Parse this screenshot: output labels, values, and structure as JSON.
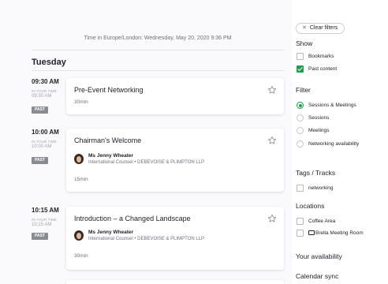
{
  "schedule": {
    "timezone_note": "Time in Europe/London: Wednesday, May 20, 2020 9:36 PM",
    "day": "Tuesday",
    "your_time_label": "IN YOUR TIME:",
    "past_badge": "PAST",
    "sessions": [
      {
        "time": "09:30 AM",
        "your_time": "09:30 AM",
        "title": "Pre-Event Networking",
        "duration": "30min"
      },
      {
        "time": "10:00 AM",
        "your_time": "10:00 AM",
        "title": "Chairman's Welcome",
        "speaker_name": "Ms Jenny Wheater",
        "speaker_role": "International Counsel • DEBEVOISE & PLIMPTON LLP",
        "duration": "15min"
      },
      {
        "time": "10:15 AM",
        "your_time": "10:15 AM",
        "title": "Introduction – a Changed Landscape",
        "speaker_name": "Ms Jenny Wheater",
        "speaker_role": "International Counsel • DEBEVOISE & PLIMPTON LLP",
        "duration": "30min"
      }
    ]
  },
  "filters": {
    "clear_label": "Clear filters",
    "show_title": "Show",
    "show_options": [
      {
        "label": "Bookmarks",
        "checked": false
      },
      {
        "label": "Past content",
        "checked": true
      }
    ],
    "filter_title": "Filter",
    "filter_options": [
      {
        "label": "Sessions & Meetings",
        "selected": true
      },
      {
        "label": "Sessions",
        "selected": false
      },
      {
        "label": "Meetings",
        "selected": false
      },
      {
        "label": "Networking availability",
        "selected": false
      }
    ],
    "tags_title": "Tags / Tracks",
    "tags_options": [
      {
        "label": "networking",
        "checked": false
      }
    ],
    "locations_title": "Locations",
    "locations_options": [
      {
        "label": "Coffee Area",
        "checked": false
      },
      {
        "label": "Brella Meeting Room",
        "checked": false,
        "icon": "meeting-room-icon"
      }
    ],
    "availability_title": "Your availability",
    "calendar_title": "Calendar sync"
  },
  "colors": {
    "accent": "#1f9d4b",
    "past_badge": "#8a8a93"
  }
}
